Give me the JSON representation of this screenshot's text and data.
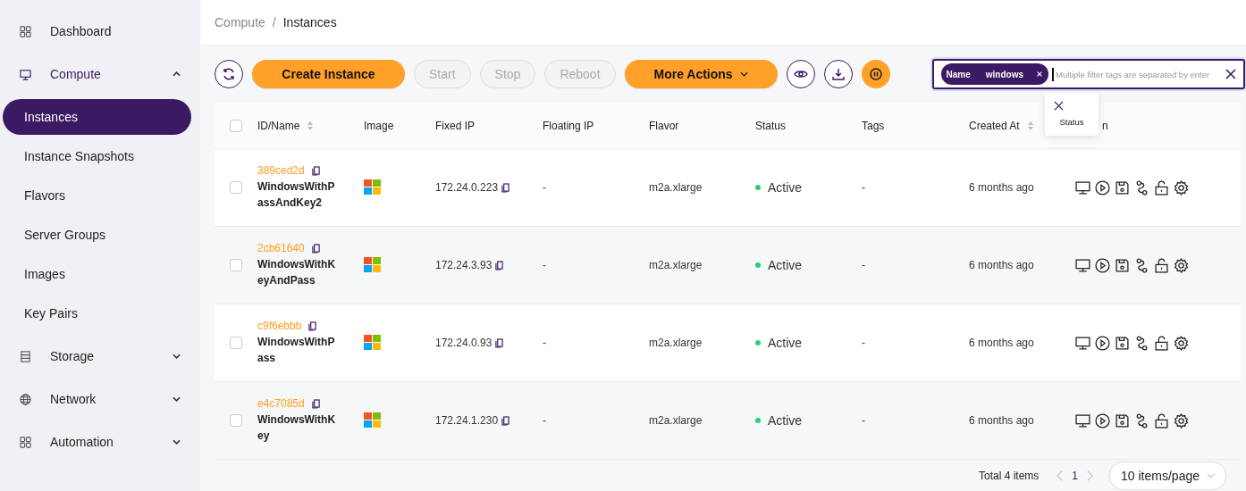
{
  "sidebar": {
    "items": [
      {
        "label": "Dashboard",
        "selected": false
      },
      {
        "label": "Compute",
        "expanded": true,
        "selected": true,
        "children": [
          {
            "label": "Instances",
            "selected": true
          },
          {
            "label": "Instance Snapshots",
            "selected": false
          },
          {
            "label": "Flavors",
            "selected": false
          },
          {
            "label": "Server Groups",
            "selected": false
          },
          {
            "label": "Images",
            "selected": false
          },
          {
            "label": "Key Pairs",
            "selected": false
          }
        ]
      },
      {
        "label": "Storage",
        "expanded": false,
        "selected": false
      },
      {
        "label": "Network",
        "expanded": false,
        "selected": false
      },
      {
        "label": "Automation",
        "expanded": false,
        "selected": false
      }
    ]
  },
  "breadcrumb": {
    "items": [
      "Compute",
      "Instances"
    ],
    "separator": "/"
  },
  "toolbar": {
    "buttons": [
      {
        "label": "Create Instance",
        "kind": "primary",
        "disabled": false,
        "dropdown": false
      },
      {
        "label": "Start",
        "kind": "default",
        "disabled": true,
        "dropdown": false
      },
      {
        "label": "Stop",
        "kind": "default",
        "disabled": true,
        "dropdown": false
      },
      {
        "label": "Reboot",
        "kind": "default",
        "disabled": true,
        "dropdown": false
      },
      {
        "label": "More Actions",
        "kind": "primary",
        "disabled": false,
        "dropdown": true
      }
    ]
  },
  "filter": {
    "tags": [
      {
        "label": "Name",
        "value": "windows"
      }
    ],
    "placeholder": "Multiple filter tags are separated by enter",
    "suggestion": "Status"
  },
  "table": {
    "select_all": false,
    "columns": [
      {
        "label": "ID/Name",
        "sortable": true
      },
      {
        "label": "Image",
        "sortable": false
      },
      {
        "label": "Fixed IP",
        "sortable": false
      },
      {
        "label": "Floating IP",
        "sortable": false
      },
      {
        "label": "Flavor",
        "sortable": false
      },
      {
        "label": "Status",
        "sortable": false
      },
      {
        "label": "Tags",
        "sortable": false
      },
      {
        "label": "Created At",
        "sortable": true
      },
      {
        "label": "n",
        "sortable": false
      }
    ],
    "rows": [
      {
        "checked": false,
        "id": "389ced2d",
        "name": "WindowsWithPassAndKey2",
        "fixed_ip": "172.24.0.223",
        "floating_ip": "-",
        "flavor": "m2a.xlarge",
        "status": "Active",
        "tags": "-",
        "created_at": "6 months ago"
      },
      {
        "checked": false,
        "id": "2cb61640",
        "name": "WindowsWithKeyAndPass",
        "fixed_ip": "172.24.3.93",
        "floating_ip": "-",
        "flavor": "m2a.xlarge",
        "status": "Active",
        "tags": "-",
        "created_at": "6 months ago"
      },
      {
        "checked": false,
        "id": "c9f6ebbb",
        "name": "WindowsWithPass",
        "fixed_ip": "172.24.0.93",
        "floating_ip": "-",
        "flavor": "m2a.xlarge",
        "status": "Active",
        "tags": "-",
        "created_at": "6 months ago"
      },
      {
        "checked": false,
        "id": "e4c7085d",
        "name": "WindowsWithKey",
        "fixed_ip": "172.24.1.230",
        "floating_ip": "-",
        "flavor": "m2a.xlarge",
        "status": "Active",
        "tags": "-",
        "created_at": "6 months ago"
      }
    ]
  },
  "pagination": {
    "total": "Total 4 items",
    "pages": [
      {
        "label": "1",
        "selected": true
      }
    ],
    "page_size": "10 items/page"
  }
}
